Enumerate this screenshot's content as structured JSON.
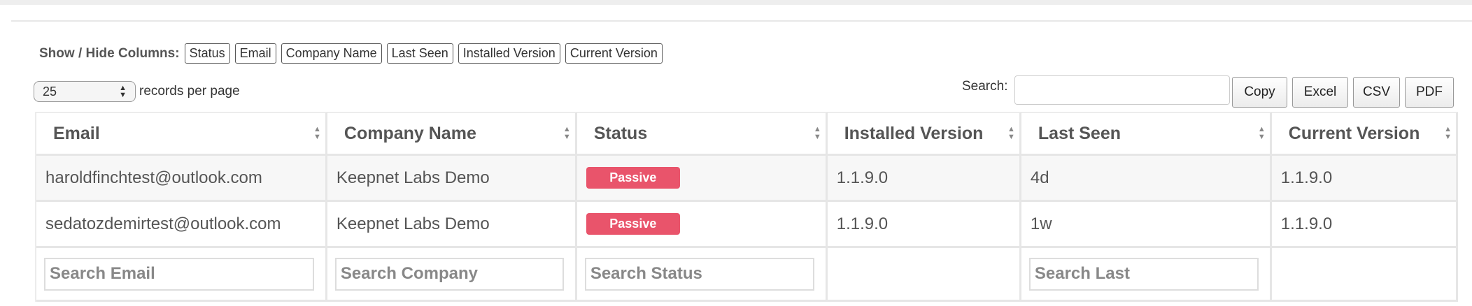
{
  "column_toggle": {
    "label": "Show / Hide Columns:",
    "buttons": [
      "Status",
      "Email",
      "Company Name",
      "Last Seen",
      "Installed Version",
      "Current Version"
    ]
  },
  "page_length": {
    "value": "25",
    "label": "records per page"
  },
  "search": {
    "label": "Search:",
    "value": ""
  },
  "export_buttons": [
    "Copy",
    "Excel",
    "CSV",
    "PDF"
  ],
  "table": {
    "columns": [
      "Email",
      "Company Name",
      "Status",
      "Installed Version",
      "Last Seen",
      "Current Version"
    ],
    "rows": [
      {
        "email": "haroldfinchtest@outlook.com",
        "company": "Keepnet Labs Demo",
        "status": "Passive",
        "installed": "1.1.9.0",
        "last_seen": "4d",
        "current": "1.1.9.0"
      },
      {
        "email": "sedatozdemirtest@outlook.com",
        "company": "Keepnet Labs Demo",
        "status": "Passive",
        "installed": "1.1.9.0",
        "last_seen": "1w",
        "current": "1.1.9.0"
      }
    ],
    "footer_search": {
      "email": "Search Email",
      "company": "Search Company",
      "status": "Search Status",
      "last_seen": "Search Last"
    }
  },
  "colors": {
    "status_passive": "#e9546b",
    "stripe": "#f7f7f7"
  }
}
